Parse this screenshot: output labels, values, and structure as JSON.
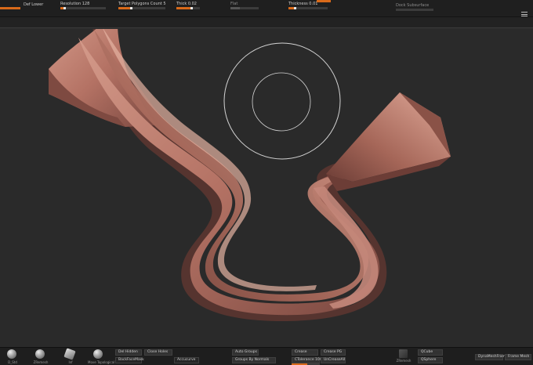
{
  "top": {
    "label_1": "Def Lower",
    "resolution": "Resolution 128",
    "target_polygons": "Target Polygons Count 5",
    "thick": "Thick 0.02",
    "flat": "Flat",
    "thickness": "Thickness 0.01",
    "label_right": "Dock Subsurface"
  },
  "brushes": [
    {
      "label": "D_Std"
    },
    {
      "label": "ZRemesh"
    },
    {
      "label": "Inf"
    },
    {
      "label": "Move Topological"
    }
  ],
  "bottom": {
    "del_hidden": "Del Hidden",
    "close_holes": "Close Holes",
    "backfacemask": "BackFaceMask",
    "accucurve": "Accucurve",
    "auto_groups": "Auto Groups",
    "groups_by_normals": "Groups By Normals",
    "crease": "Crease",
    "crease_pg": "Crease PG",
    "ctolerance": "CTolerance 100",
    "uncreaseall": "UnCreaseAll",
    "zremesh_tile": "ZRemesh",
    "qcube": "QCube",
    "qsphere": "QSphere",
    "dynamesh_shell": "DynaMeshFramer",
    "frame_mesh": "Frame Mesh"
  },
  "colors": {
    "accent": "#d96a1a",
    "mesh": "#b8776a",
    "viewport": "#2a2a2a"
  }
}
